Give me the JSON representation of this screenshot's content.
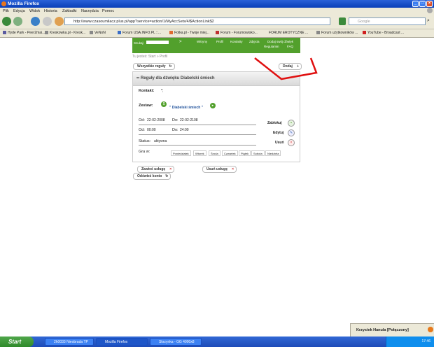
{
  "window": {
    "title": "Mozilla Firefox"
  },
  "menu": [
    "Plik",
    "Edycja",
    "Widok",
    "Historia",
    "Zakładki",
    "Narzędzia",
    "Pomoc"
  ],
  "nav": {
    "url": "http://www.czasoumilacz.plus.pl/app?service=action/1/MyAccSets/4/$ActionLink$2",
    "search_placeholder": "Google"
  },
  "bookmarks": [
    "Hyde Park - Peer2mai...",
    "Kreskowka.pl - Kresk...",
    "VeNoN",
    "Forum USA.INFO.PL ::...",
    "Fotka.pl - Twoje miej...",
    "Forum - Forumowisko...",
    "FORUM EROTYCZNE ...",
    "Forum użytkowników ...",
    "YouTube - Broadcast ..."
  ],
  "site": {
    "search_label": "Szukaj:",
    "search_go": ">",
    "nav_links": [
      "Witryny",
      "Profil",
      "Kontakty",
      "Zdjęcia",
      "Dodaj swój dźwięk",
      "Regulamin",
      "FAQ"
    ],
    "breadcrumb": "Tu jesteś: Start » Profil",
    "all_rules_btn": "Wszystkie reguły",
    "add_btn": "Dodaj",
    "panel_title": "Reguły dla dźwięku Diabelski śmiech",
    "contact_label": "Kontakt:",
    "contact_value": "*;",
    "set_label": "Zestaw:",
    "set_value": "\" Diabelski śmiech \"",
    "from_date_label": "Od:",
    "from_date": "22-02-2008",
    "to_date_label": "Do:",
    "to_date": "22-02-2108",
    "from_time_label": "Od:",
    "from_time": "00:00",
    "to_time_label": "Do:",
    "to_time": "24:00",
    "status_label": "Status:",
    "status_value": "aktywna",
    "days_label": "Gra w:",
    "days": [
      "Poniedziałek",
      "Wtorek",
      "Środa",
      "Czwartek",
      "Piątek",
      "Sobota",
      "Niedziela"
    ],
    "block_btn": "Zablokuj",
    "edit_btn": "Edytuj",
    "delete_btn": "Usuń",
    "suspend_service_btn": "Zawieś usługę",
    "delete_service_btn": "Usuń usługę",
    "refresh_account_btn": "Odśwież konto"
  },
  "status_area": {
    "user": "Krzysiek Hanula [Połączony]"
  },
  "taskbar": {
    "start": "Start",
    "tasks": [
      "2h0033 Nieobrada TP",
      "Mozilla Firefox",
      "Skrzynka - GG 4900x8"
    ],
    "clock": "17:46"
  }
}
